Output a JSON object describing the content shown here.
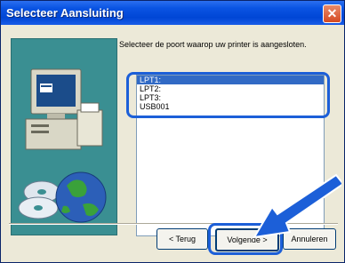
{
  "window": {
    "title": "Selecteer Aansluiting",
    "close_glyph": "✕"
  },
  "instruction": "Selecteer de poort waarop uw printer is aangesloten.",
  "ports": [
    {
      "label": "LPT1:",
      "selected": true
    },
    {
      "label": "LPT2:",
      "selected": false
    },
    {
      "label": "LPT3:",
      "selected": false
    },
    {
      "label": "USB001",
      "selected": false
    }
  ],
  "buttons": {
    "back": "< Terug",
    "next": "Volgende >",
    "cancel": "Annuleren"
  },
  "colors": {
    "title_bar": "#0a54e3",
    "highlight": "#1c5fd8",
    "selection": "#316ac5",
    "illustration_bg": "#3a8f92"
  },
  "icons": [
    "computer-icon",
    "cd-icon",
    "globe-icon",
    "pointer-arrow-icon"
  ]
}
